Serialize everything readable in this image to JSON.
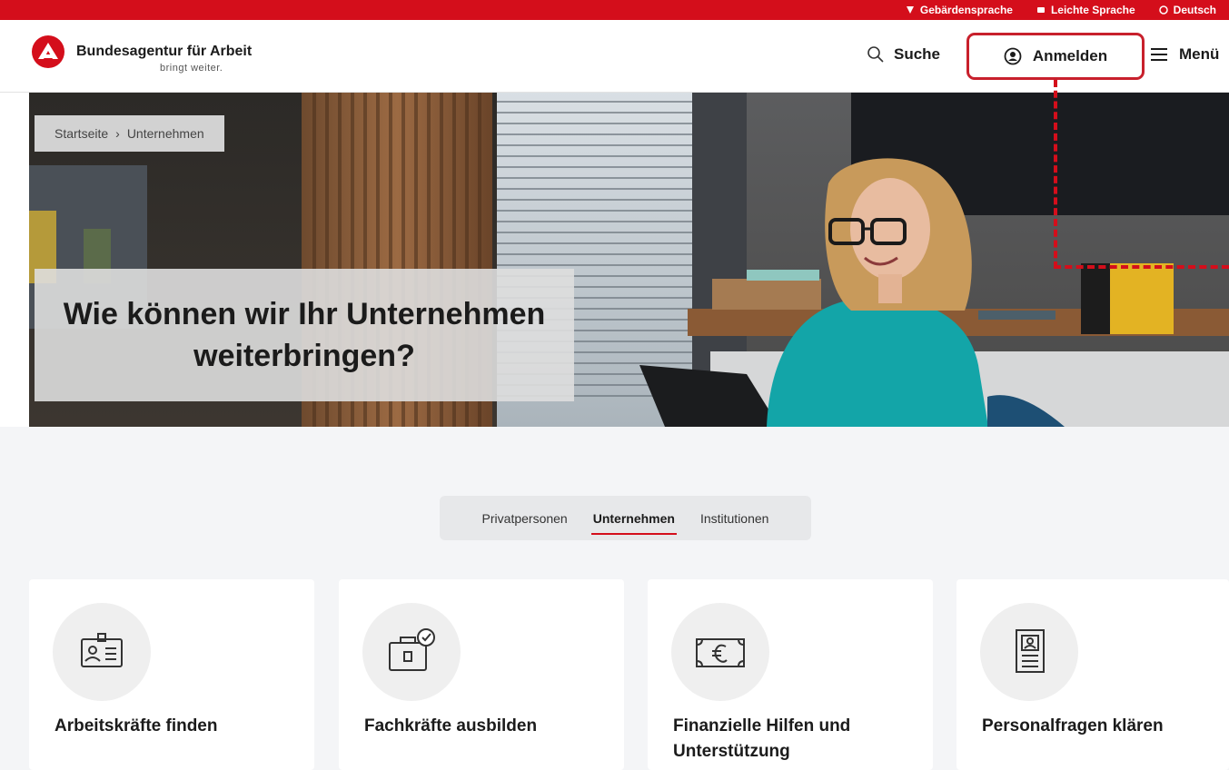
{
  "topbar": {
    "items": [
      {
        "label": "Gebärdensprache",
        "icon": "sign-language-icon"
      },
      {
        "label": "Leichte Sprache",
        "icon": "easy-language-icon"
      },
      {
        "label": "Deutsch",
        "icon": "globe-icon"
      }
    ]
  },
  "header": {
    "brand_name": "Bundesagentur für Arbeit",
    "brand_slogan": "bringt weiter.",
    "search_label": "Suche",
    "login_label": "Anmelden",
    "menu_label": "Menü"
  },
  "breadcrumb": [
    "Startseite",
    "Unternehmen"
  ],
  "hero": {
    "title": "Wie können wir Ihr Unternehmen weiterbringen?"
  },
  "tabs": [
    {
      "label": "Privatpersonen",
      "active": false
    },
    {
      "label": "Unternehmen",
      "active": true
    },
    {
      "label": "Institutionen",
      "active": false
    }
  ],
  "cards": [
    {
      "title": "Arbeitskräfte finden",
      "icon": "id-badge-icon"
    },
    {
      "title": "Fachkräfte ausbilden",
      "icon": "briefcase-check-icon"
    },
    {
      "title": "Finanzielle Hilfen und Unterstützung",
      "icon": "euro-banknote-icon"
    },
    {
      "title": "Personalfragen klären",
      "icon": "personnel-document-icon"
    }
  ],
  "colors": {
    "brand_red": "#d40e1b",
    "highlight_red": "#c8202c",
    "page_gray": "#f4f5f7"
  }
}
